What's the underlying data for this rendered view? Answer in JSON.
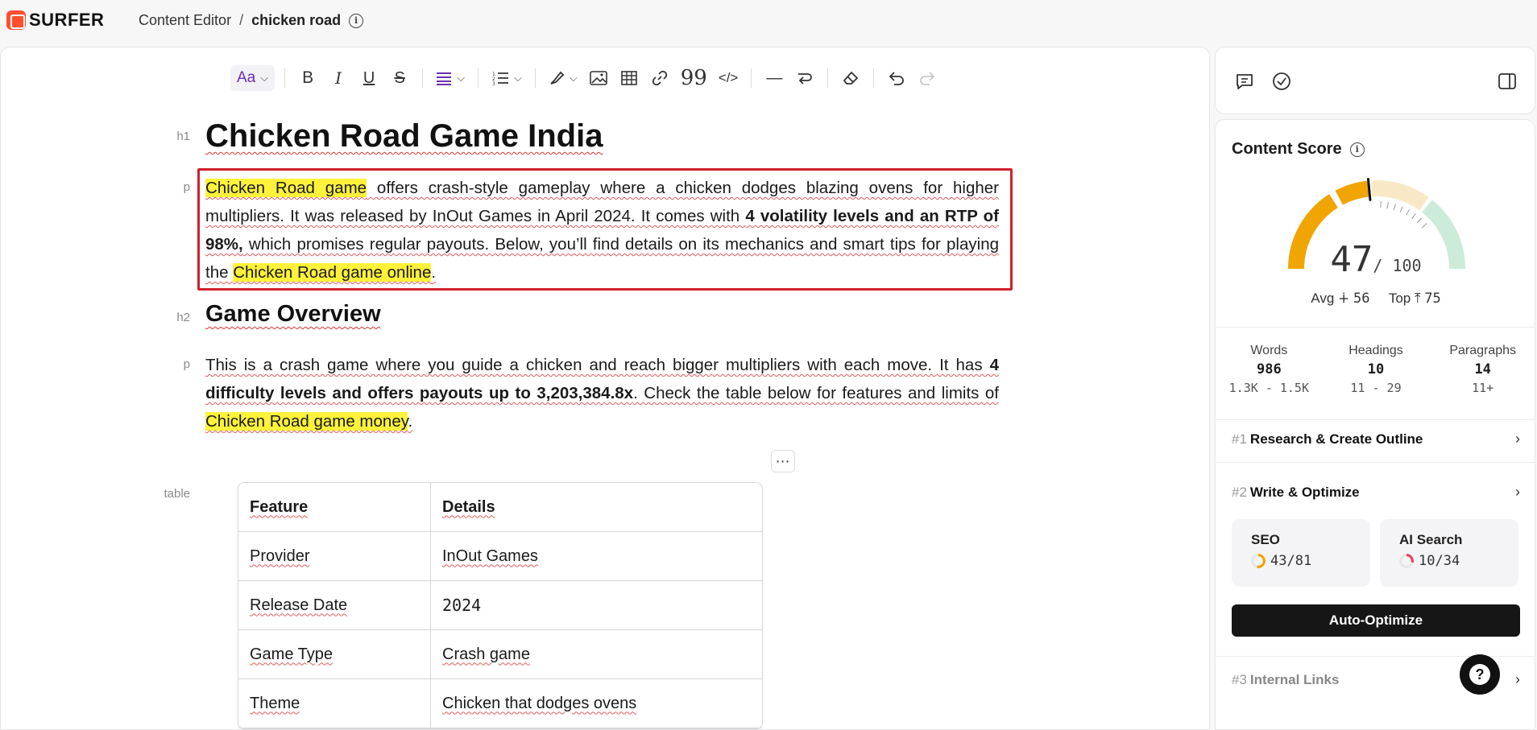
{
  "app": {
    "logo_text": "SURFER"
  },
  "breadcrumb": {
    "section": "Content Editor",
    "separator": "/",
    "document": "chicken road"
  },
  "toolbar": {
    "style_label": "Aa",
    "icons": [
      "bold-icon",
      "italic-icon",
      "underline-icon",
      "strikethrough-icon",
      "align-icon",
      "list-icon",
      "highlight-icon",
      "image-icon",
      "table-icon",
      "link-icon",
      "quote-icon",
      "code-icon",
      "divider-icon",
      "wrap-icon",
      "eraser-icon",
      "undo-icon",
      "redo-icon"
    ]
  },
  "editor": {
    "labels": {
      "h1": "h1",
      "p": "p",
      "h2": "h2",
      "table": "table"
    },
    "h1": "Chicken Road Game India",
    "p1": {
      "hl1": "Chicken Road game",
      "t1": " offers crash-style gameplay where a chicken dodges blazing ovens for higher multipliers. It was released by InOut Games in April 2024. It comes with ",
      "b1": "4 volatility levels and an RTP of 98%,",
      "t2": " which promises regular payouts. Below, you’ll find details on its mechanics and smart tips for playing the ",
      "hl2": "Chicken Road game online",
      "t3": "."
    },
    "h2": "Game Overview",
    "p2": {
      "t1": "This is a crash game where you guide a chicken and reach bigger multipliers with each move. It has ",
      "b1": "4 difficulty levels and offers payouts up to 3,203,384.8x",
      "t2": ". Check the table below for features and limits of ",
      "hl1": "Chicken Road game money",
      "t3": "."
    },
    "more_label": "⋯",
    "table": {
      "headers": [
        "Feature",
        "Details"
      ],
      "rows": [
        [
          "Provider",
          "InOut Games"
        ],
        [
          "Release Date",
          "2024"
        ],
        [
          "Game Type",
          "Crash game"
        ],
        [
          "Theme",
          "Chicken that dodges ovens"
        ]
      ]
    }
  },
  "score_panel": {
    "title": "Content Score",
    "score": "47",
    "max": "/ 100",
    "score_value": 47,
    "avg_label": "Avg",
    "avg_value": "56",
    "top_label": "Top",
    "top_value": "75",
    "stats": [
      {
        "label": "Words",
        "value": "986",
        "range": "1.3K - 1.5K"
      },
      {
        "label": "Headings",
        "value": "10",
        "range": "11 - 29"
      },
      {
        "label": "Paragraphs",
        "value": "14",
        "range": "11+"
      }
    ],
    "steps": [
      {
        "num": "#1",
        "name": "Research & Create Outline"
      },
      {
        "num": "#2",
        "name": "Write & Optimize"
      },
      {
        "num": "#3",
        "name": "Internal Links"
      }
    ],
    "seo": {
      "label": "SEO",
      "value": "43/81",
      "fraction": 0.53
    },
    "ai": {
      "label": "AI Search",
      "value": "10/34",
      "fraction": 0.29
    },
    "auto_optimize": "Auto-Optimize",
    "colors": {
      "accent": "#f0a500",
      "good": "#cdebd9",
      "warn": "#f9e8c5",
      "ai_ring": "#e0445a"
    }
  },
  "help": {
    "label": "?"
  }
}
